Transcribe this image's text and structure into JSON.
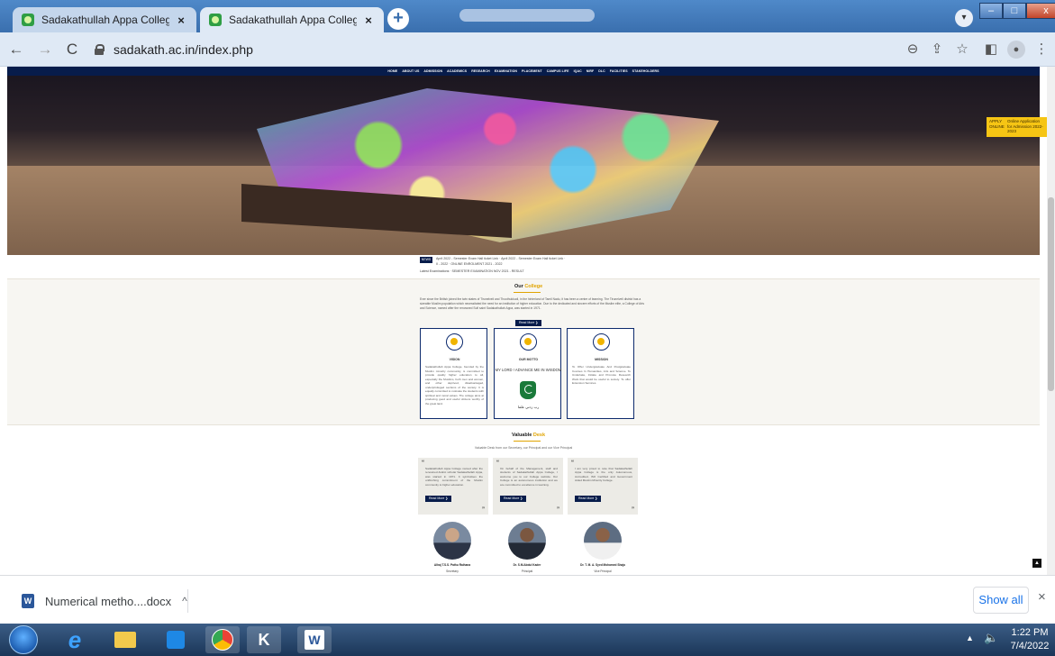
{
  "browser": {
    "tabs": [
      {
        "title": "Sadakathullah Appa College, Pala",
        "close": "×"
      },
      {
        "title": "Sadakathullah Appa College, Pala",
        "close": "×"
      }
    ],
    "new_tab": "+",
    "url": "sadakath.ac.in/index.php",
    "nav": {
      "back": "←",
      "forward": "→",
      "reload": "C"
    },
    "tools": {
      "zoom": "⊖",
      "share": "⇪",
      "bookmark": "☆",
      "sidepanel": "◧",
      "menu": "⋮"
    },
    "window": {
      "minimize": "–",
      "maximize": "□",
      "close": "x"
    }
  },
  "site": {
    "nav_items": [
      "HOME",
      "ABOUT US",
      "ADMISSION",
      "ACADEMICS",
      "RESEARCH",
      "EXAMINATION",
      "PLACEMENT",
      "CAMPUS LIFE",
      "IQAC",
      "NIRF",
      "DLC",
      "FACILITIES",
      "STAKEHOLDERS"
    ],
    "admission_badge": {
      "left": "APPLY ONLINE",
      "right": "Online Application for Admission 2022-2023"
    },
    "marquee": {
      "tag": "NEWS",
      "line1": "April 2022 - Semester Exam Hall ticket Link ·  April 2022 - Semester Exam Hall ticket Link ·",
      "line2": "II - 2022 ·  ONLINE ENROLMENT 2021 - 2022",
      "line3": "Latest Examinations   ·   SEMESTER EXAMINATION NOV 2021 - RESULT"
    },
    "our_college": {
      "heading_plain": "Our ",
      "heading_accent": "College",
      "para": "Ever since the British joined the twin states of Tirunelveli and Thoothukkudi, in the hinterland of Tamil Nadu, it has been a centre of learning. The Tirunelveli district has a sizeable Muslim population which necessitated the need for an institution of higher education. Due to the dedicated and sincere efforts of the Muslim elite, a College of Arts and Science, named after the renowned Sufi saint Sadakathullah Appa, was started in 1971.",
      "read_more": "Read More"
    },
    "cards": [
      {
        "title": "VISION",
        "text": "Sadakathullah Appa College, founded by the Muslim minority community, is committed to provide quality higher education to all, especially the Muslims, both men and women, and other deprived, disadvantaged, underprivileged sections of the society. It is equally committed to motivate the students with spiritual and moral values. The college aims at producing good and useful citizens worthy of the great land."
      },
      {
        "title": "OUR MOTTO",
        "motto": "MY LORD ! ADVANCE ME IN WISDOM",
        "urdu": "رب زدني علما"
      },
      {
        "title": "MISSION",
        "text": "To Offer Undergraduate And Postgraduate Courses In Humanities, Arts and Science. To Undertake, Initiate and Promote Research Work that would be useful to society. To offer Extension Services."
      }
    ],
    "valuable_desk": {
      "heading_plain": "Valuable ",
      "heading_accent": "Desk",
      "subtitle": "Valuable Desk from our Secretary, our Principal and our Vice Principal",
      "quotes": [
        {
          "text": "Sadakathullah Appa College named after the renowned Arabic scholar Sadakathullah Appa, was started in 1971. It symbolises the unflinching commitment of the Muslim community to higher education.",
          "read_more": "Read More"
        },
        {
          "text": "On behalf of the Management, staff and students of Sadakathullah Appa College, I welcome you to our College website. Our College is an autonomous institution and we are committed to excellence in learning.",
          "read_more": "Read More"
        },
        {
          "text": "I am very proud to note that Sadakathullah Appa College is the only Autonomous, Accredited, ISO Certified and Government Aided Muslim Minority College.",
          "read_more": "Read More"
        }
      ],
      "people": [
        {
          "name": "Alhaj T.S.S. Pathu Raihana",
          "role": "Secretary"
        },
        {
          "name": "Dr. S.M.Abdul Kader",
          "role": "Principal"
        },
        {
          "name": "Dr. T. M. A. Syed Mohamed Shaja",
          "role": "Vice Principal"
        }
      ]
    }
  },
  "downloads": {
    "file": "Numerical metho....docx",
    "caret": "^",
    "show_all": "Show all",
    "close": "×"
  },
  "taskbar": {
    "time": "1:22 PM",
    "date": "7/4/2022"
  }
}
